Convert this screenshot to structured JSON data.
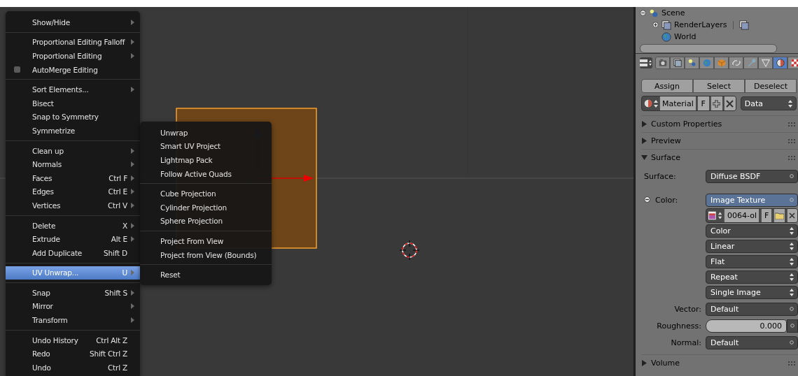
{
  "menu": {
    "sections": [
      {
        "items": [
          {
            "label": "Show/Hide",
            "submenu": true,
            "selected": false,
            "kind": "command"
          }
        ]
      },
      {
        "items": [
          {
            "label": "Proportional Editing Falloff",
            "submenu": true,
            "selected": false,
            "kind": "command"
          },
          {
            "label": "Proportional Editing",
            "submenu": true,
            "selected": false,
            "kind": "command"
          },
          {
            "label": "AutoMerge Editing",
            "submenu": false,
            "selected": false,
            "kind": "checkbox",
            "checked": false
          }
        ]
      },
      {
        "items": [
          {
            "label": "Sort Elements...",
            "submenu": true,
            "selected": false,
            "kind": "command"
          },
          {
            "label": "Bisect",
            "submenu": false,
            "selected": false,
            "kind": "command"
          },
          {
            "label": "Snap to Symmetry",
            "submenu": false,
            "selected": false,
            "kind": "command"
          },
          {
            "label": "Symmetrize",
            "submenu": false,
            "selected": false,
            "kind": "command"
          }
        ]
      },
      {
        "items": [
          {
            "label": "Clean up",
            "submenu": true,
            "selected": false,
            "kind": "command"
          },
          {
            "label": "Normals",
            "submenu": true,
            "selected": false,
            "kind": "command"
          },
          {
            "label": "Faces",
            "shortcut": "Ctrl F",
            "submenu": true,
            "selected": false,
            "kind": "command"
          },
          {
            "label": "Edges",
            "shortcut": "Ctrl E",
            "submenu": true,
            "selected": false,
            "kind": "command"
          },
          {
            "label": "Vertices",
            "shortcut": "Ctrl V",
            "submenu": true,
            "selected": false,
            "kind": "command"
          }
        ]
      },
      {
        "items": [
          {
            "label": "Delete",
            "shortcut": "X",
            "submenu": true,
            "selected": false,
            "kind": "command"
          },
          {
            "label": "Extrude",
            "shortcut": "Alt E",
            "submenu": true,
            "selected": false,
            "kind": "command"
          },
          {
            "label": "Add Duplicate",
            "shortcut": "Shift D",
            "submenu": false,
            "selected": false,
            "kind": "command"
          }
        ]
      },
      {
        "items": [
          {
            "label": "UV Unwrap...",
            "shortcut": "U",
            "submenu": true,
            "selected": true,
            "kind": "command"
          }
        ]
      },
      {
        "items": [
          {
            "label": "Snap",
            "shortcut": "Shift S",
            "submenu": true,
            "selected": false,
            "kind": "command"
          },
          {
            "label": "Mirror",
            "submenu": true,
            "selected": false,
            "kind": "command"
          },
          {
            "label": "Transform",
            "submenu": true,
            "selected": false,
            "kind": "command"
          }
        ]
      },
      {
        "items": [
          {
            "label": "Undo History",
            "shortcut": "Ctrl Alt Z",
            "submenu": false,
            "selected": false,
            "kind": "command"
          },
          {
            "label": "Redo",
            "shortcut": "Shift Ctrl Z",
            "submenu": false,
            "selected": false,
            "kind": "command"
          },
          {
            "label": "Undo",
            "shortcut": "Ctrl Z",
            "submenu": false,
            "selected": false,
            "kind": "command"
          }
        ]
      }
    ]
  },
  "submenu": {
    "sections": [
      {
        "items": [
          {
            "label": "Unwrap",
            "selected": false
          },
          {
            "label": "Smart UV Project",
            "selected": false
          },
          {
            "label": "Lightmap Pack",
            "selected": false
          },
          {
            "label": "Follow Active Quads",
            "selected": false
          }
        ]
      },
      {
        "items": [
          {
            "label": "Cube Projection",
            "selected": false
          },
          {
            "label": "Cylinder Projection",
            "selected": false
          },
          {
            "label": "Sphere Projection",
            "selected": false
          }
        ]
      },
      {
        "items": [
          {
            "label": "Project From View",
            "selected": false
          },
          {
            "label": "Project from View (Bounds)",
            "selected": false
          }
        ]
      },
      {
        "items": [
          {
            "label": "Reset",
            "selected": false
          }
        ]
      }
    ]
  },
  "outliner": {
    "items": [
      {
        "label": "Scene",
        "kind": "scene",
        "expanded": true,
        "children": [
          {
            "label": "RenderLayers",
            "kind": "render_layers",
            "expanded": false
          },
          {
            "label": "World",
            "kind": "world"
          }
        ]
      }
    ]
  },
  "properties": {
    "tabs": [
      {
        "kind": "render",
        "selected": false
      },
      {
        "kind": "render_layers",
        "selected": false
      },
      {
        "kind": "scene",
        "selected": false
      },
      {
        "kind": "world",
        "selected": false
      },
      {
        "kind": "object",
        "selected": false
      },
      {
        "kind": "constraints",
        "selected": false
      },
      {
        "kind": "modifiers",
        "selected": false
      },
      {
        "kind": "data",
        "selected": false
      },
      {
        "kind": "material",
        "selected": true
      },
      {
        "kind": "texture",
        "selected": false
      }
    ],
    "buttons": [
      "Assign",
      "Select",
      "Deselect"
    ],
    "material_slot": {
      "name": "Material",
      "fake_user": "F",
      "link": "Data"
    },
    "panels": [
      {
        "title": "Custom Properties",
        "expanded": false
      },
      {
        "title": "Preview",
        "expanded": false
      },
      {
        "title": "Surface",
        "expanded": true,
        "rows": [
          {
            "kind": "menu",
            "label": "Surface:",
            "value": "Diffuse BSDF",
            "highlighted": false,
            "linked": false
          },
          {
            "kind": "menu",
            "label": "Color:",
            "value": "Image Texture",
            "highlighted": true,
            "linked": true
          },
          {
            "kind": "image",
            "name": "0064-ol",
            "fake_user": "F"
          },
          {
            "kind": "select",
            "value": "Color"
          },
          {
            "kind": "select",
            "value": "Linear"
          },
          {
            "kind": "select",
            "value": "Flat"
          },
          {
            "kind": "select",
            "value": "Repeat"
          },
          {
            "kind": "select",
            "value": "Single Image"
          },
          {
            "kind": "menu",
            "label": "Vector:",
            "value": "Default",
            "highlighted": false,
            "linked": false
          },
          {
            "kind": "slider",
            "label": "Roughness:",
            "value": "0.000",
            "level": 0
          },
          {
            "kind": "menu",
            "label": "Normal:",
            "value": "Default",
            "highlighted": false,
            "linked": false
          }
        ]
      },
      {
        "title": "Volume",
        "expanded": false
      }
    ]
  }
}
